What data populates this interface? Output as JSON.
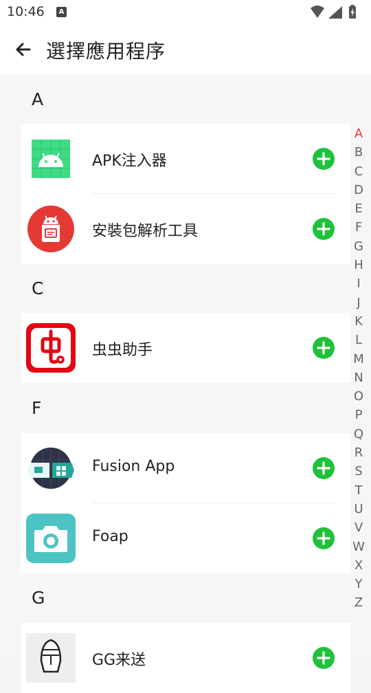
{
  "status_bar": {
    "time": "10:46",
    "notification_badge": "A"
  },
  "header": {
    "title": "選擇應用程序",
    "back_icon": "arrow-left-icon"
  },
  "sections": [
    {
      "letter": "A",
      "apps": [
        {
          "name": "APK注入器",
          "icon": "android-grid-icon"
        },
        {
          "name": "安裝包解析工具",
          "icon": "android-package-icon"
        }
      ]
    },
    {
      "letter": "C",
      "apps": [
        {
          "name": "虫虫助手",
          "icon": "chongchong-logo-icon"
        }
      ]
    },
    {
      "letter": "F",
      "apps": [
        {
          "name": "Fusion App",
          "icon": "fusion-app-icon"
        },
        {
          "name": "Foap",
          "icon": "camera-icon"
        }
      ]
    },
    {
      "letter": "G",
      "apps": [
        {
          "name": "GG来送",
          "icon": "helmet-icon"
        }
      ]
    }
  ],
  "index_bar": {
    "letters": [
      "A",
      "B",
      "C",
      "D",
      "E",
      "F",
      "G",
      "H",
      "I",
      "J",
      "K",
      "L",
      "M",
      "N",
      "O",
      "P",
      "Q",
      "R",
      "S",
      "T",
      "U",
      "V",
      "W",
      "X",
      "Y",
      "Z"
    ],
    "active": "A"
  },
  "colors": {
    "add_button": "#1fc13a",
    "index_active": "#e53935",
    "index_default": "#666666",
    "background": "#f6f6f6"
  }
}
